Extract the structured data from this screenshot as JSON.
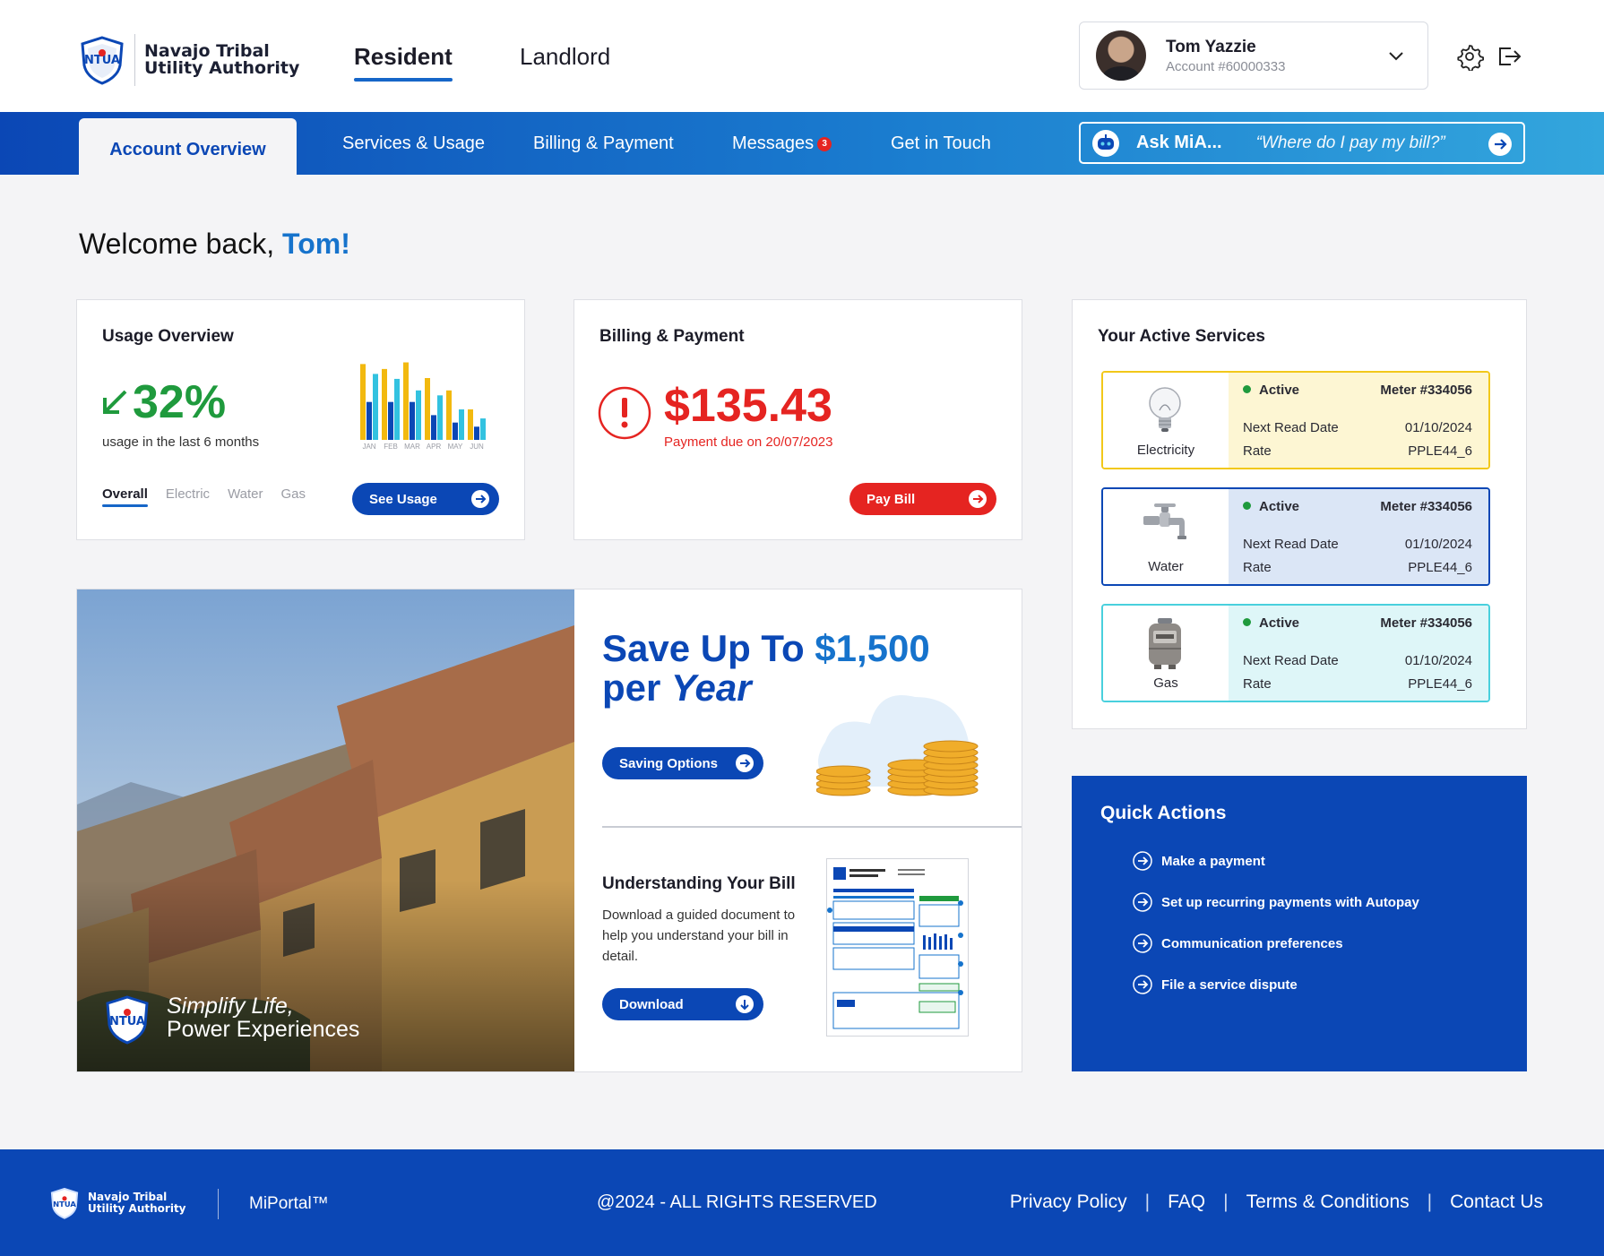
{
  "brand": {
    "line1": "Navajo Tribal",
    "line2": "Utility Authority",
    "logo_text": "NTUA"
  },
  "roles": [
    {
      "label": "Resident",
      "active": true
    },
    {
      "label": "Landlord",
      "active": false
    }
  ],
  "user": {
    "name": "Tom Yazzie",
    "account": "Account #60000333"
  },
  "icons": {
    "settings": "gear-icon",
    "logout": "logout-icon",
    "dropdown": "chevron-down-icon"
  },
  "nav": {
    "items": [
      {
        "label": "Account Overview",
        "active": true
      },
      {
        "label": "Services & Usage"
      },
      {
        "label": "Billing & Payment"
      },
      {
        "label": "Messages",
        "badge": "3"
      },
      {
        "label": "Get in Touch"
      }
    ],
    "ask": {
      "label": "Ask MiA...",
      "placeholder": "“Where do I pay my bill?”"
    }
  },
  "welcome": {
    "text": "Welcome back,",
    "name": "Tom!"
  },
  "usage": {
    "title": "Usage Overview",
    "percent": "32%",
    "trend": "down",
    "subtitle": "usage in the last 6 months",
    "filters": [
      "Overall",
      "Electric",
      "Water",
      "Gas"
    ],
    "active_filter": "Overall",
    "button": "See Usage",
    "chart_data": {
      "type": "bar",
      "categories": [
        "JAN",
        "FEB",
        "MAR",
        "APR",
        "MAY",
        "JUN"
      ],
      "series": [
        {
          "color": "#f2b90f",
          "values": [
            92,
            86,
            94,
            75,
            60,
            37
          ]
        },
        {
          "color": "#0b47b5",
          "values": [
            46,
            46,
            46,
            30,
            21,
            16
          ]
        },
        {
          "color": "#33c2e0",
          "values": [
            80,
            74,
            60,
            54,
            37,
            26
          ]
        }
      ],
      "ylim": [
        0,
        100
      ]
    }
  },
  "billing": {
    "title": "Billing & Payment",
    "amount": "$135.43",
    "due": "Payment due on 20/07/2023",
    "button": "Pay Bill"
  },
  "services": {
    "title": "Your Active Services",
    "items": [
      {
        "name": "Electricity",
        "status": "Active",
        "meter": "Meter #334056",
        "read_label": "Next Read Date",
        "read_date": "01/10/2024",
        "rate_label": "Rate",
        "rate": "PPLE44_6",
        "border": "#f2c81a",
        "bg": "#fdf6d3",
        "icon": "lightbulb-icon"
      },
      {
        "name": "Water",
        "status": "Active",
        "meter": "Meter #334056",
        "read_label": "Next Read Date",
        "read_date": "01/10/2024",
        "rate_label": "Rate",
        "rate": "PPLE44_6",
        "border": "#0b47b5",
        "bg": "#dbe6f6",
        "icon": "faucet-icon"
      },
      {
        "name": "Gas",
        "status": "Active",
        "meter": "Meter #334056",
        "read_label": "Next Read Date",
        "read_date": "01/10/2024",
        "rate_label": "Rate",
        "rate": "PPLE44_6",
        "border": "#49d0dd",
        "bg": "#def6f8",
        "icon": "gas-meter-icon"
      }
    ]
  },
  "promo": {
    "tagline1": "Simplify Life,",
    "tagline2": "Power Experiences",
    "save_line1a": "Save Up To ",
    "save_amount": "$1,500",
    "save_line2a": "per ",
    "save_line2b": "Year",
    "save_button": "Saving Options",
    "bill_title": "Understanding Your Bill",
    "bill_desc": "Download a guided document to help you understand your bill in detail.",
    "download_button": "Download"
  },
  "quick_actions": {
    "title": "Quick Actions",
    "items": [
      "Make a payment",
      "Set up recurring payments with Autopay",
      "Communication preferences",
      "File a service dispute"
    ]
  },
  "footer": {
    "brand_line1": "Navajo Tribal",
    "brand_line2": "Utility Authority",
    "portal": "MiPortal™",
    "copyright": "@2024 - ALL RIGHTS RESERVED",
    "links": [
      "Privacy Policy",
      "FAQ",
      "Terms & Conditions",
      "Contact Us"
    ]
  }
}
